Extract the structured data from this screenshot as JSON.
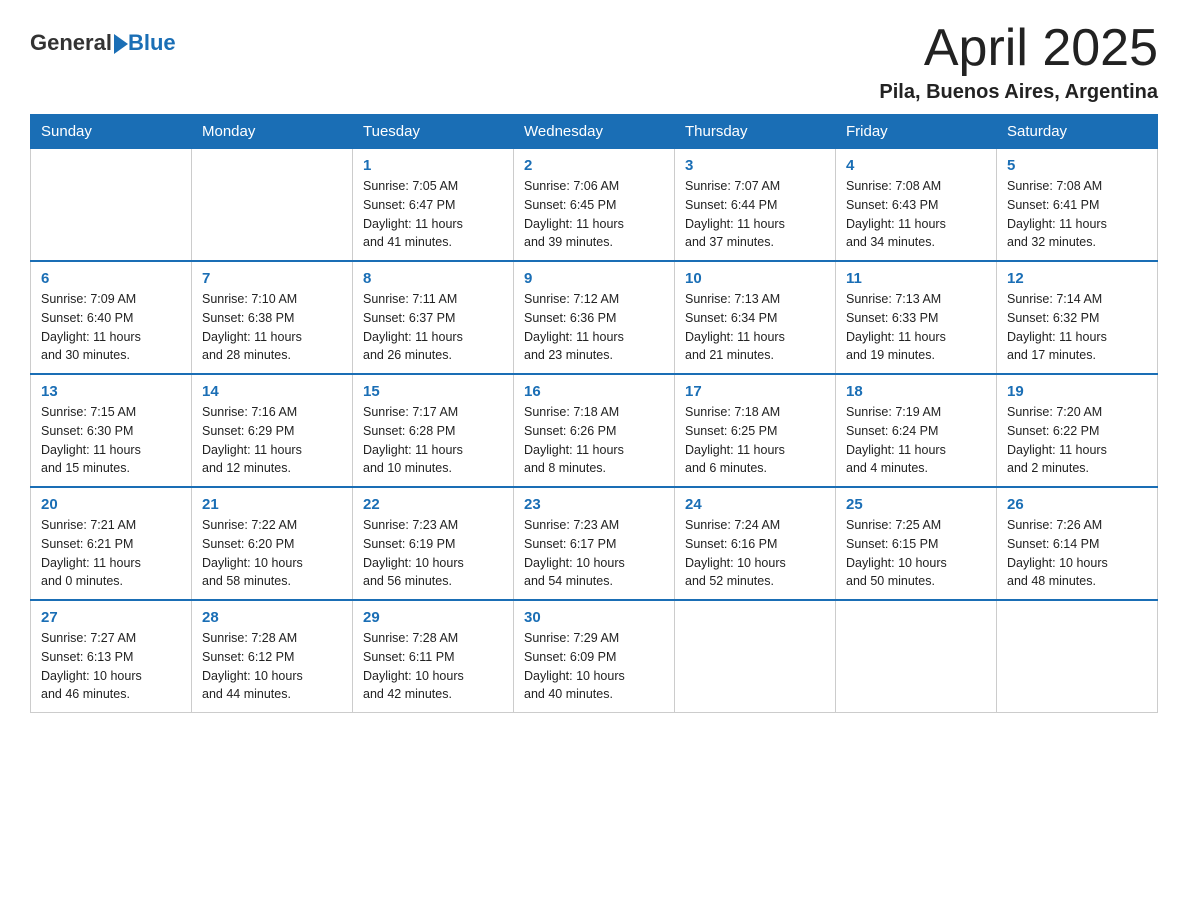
{
  "header": {
    "title": "April 2025",
    "subtitle": "Pila, Buenos Aires, Argentina",
    "logo_general": "General",
    "logo_blue": "Blue"
  },
  "days_of_week": [
    "Sunday",
    "Monday",
    "Tuesday",
    "Wednesday",
    "Thursday",
    "Friday",
    "Saturday"
  ],
  "weeks": [
    [
      {
        "day": "",
        "info": ""
      },
      {
        "day": "",
        "info": ""
      },
      {
        "day": "1",
        "info": "Sunrise: 7:05 AM\nSunset: 6:47 PM\nDaylight: 11 hours\nand 41 minutes."
      },
      {
        "day": "2",
        "info": "Sunrise: 7:06 AM\nSunset: 6:45 PM\nDaylight: 11 hours\nand 39 minutes."
      },
      {
        "day": "3",
        "info": "Sunrise: 7:07 AM\nSunset: 6:44 PM\nDaylight: 11 hours\nand 37 minutes."
      },
      {
        "day": "4",
        "info": "Sunrise: 7:08 AM\nSunset: 6:43 PM\nDaylight: 11 hours\nand 34 minutes."
      },
      {
        "day": "5",
        "info": "Sunrise: 7:08 AM\nSunset: 6:41 PM\nDaylight: 11 hours\nand 32 minutes."
      }
    ],
    [
      {
        "day": "6",
        "info": "Sunrise: 7:09 AM\nSunset: 6:40 PM\nDaylight: 11 hours\nand 30 minutes."
      },
      {
        "day": "7",
        "info": "Sunrise: 7:10 AM\nSunset: 6:38 PM\nDaylight: 11 hours\nand 28 minutes."
      },
      {
        "day": "8",
        "info": "Sunrise: 7:11 AM\nSunset: 6:37 PM\nDaylight: 11 hours\nand 26 minutes."
      },
      {
        "day": "9",
        "info": "Sunrise: 7:12 AM\nSunset: 6:36 PM\nDaylight: 11 hours\nand 23 minutes."
      },
      {
        "day": "10",
        "info": "Sunrise: 7:13 AM\nSunset: 6:34 PM\nDaylight: 11 hours\nand 21 minutes."
      },
      {
        "day": "11",
        "info": "Sunrise: 7:13 AM\nSunset: 6:33 PM\nDaylight: 11 hours\nand 19 minutes."
      },
      {
        "day": "12",
        "info": "Sunrise: 7:14 AM\nSunset: 6:32 PM\nDaylight: 11 hours\nand 17 minutes."
      }
    ],
    [
      {
        "day": "13",
        "info": "Sunrise: 7:15 AM\nSunset: 6:30 PM\nDaylight: 11 hours\nand 15 minutes."
      },
      {
        "day": "14",
        "info": "Sunrise: 7:16 AM\nSunset: 6:29 PM\nDaylight: 11 hours\nand 12 minutes."
      },
      {
        "day": "15",
        "info": "Sunrise: 7:17 AM\nSunset: 6:28 PM\nDaylight: 11 hours\nand 10 minutes."
      },
      {
        "day": "16",
        "info": "Sunrise: 7:18 AM\nSunset: 6:26 PM\nDaylight: 11 hours\nand 8 minutes."
      },
      {
        "day": "17",
        "info": "Sunrise: 7:18 AM\nSunset: 6:25 PM\nDaylight: 11 hours\nand 6 minutes."
      },
      {
        "day": "18",
        "info": "Sunrise: 7:19 AM\nSunset: 6:24 PM\nDaylight: 11 hours\nand 4 minutes."
      },
      {
        "day": "19",
        "info": "Sunrise: 7:20 AM\nSunset: 6:22 PM\nDaylight: 11 hours\nand 2 minutes."
      }
    ],
    [
      {
        "day": "20",
        "info": "Sunrise: 7:21 AM\nSunset: 6:21 PM\nDaylight: 11 hours\nand 0 minutes."
      },
      {
        "day": "21",
        "info": "Sunrise: 7:22 AM\nSunset: 6:20 PM\nDaylight: 10 hours\nand 58 minutes."
      },
      {
        "day": "22",
        "info": "Sunrise: 7:23 AM\nSunset: 6:19 PM\nDaylight: 10 hours\nand 56 minutes."
      },
      {
        "day": "23",
        "info": "Sunrise: 7:23 AM\nSunset: 6:17 PM\nDaylight: 10 hours\nand 54 minutes."
      },
      {
        "day": "24",
        "info": "Sunrise: 7:24 AM\nSunset: 6:16 PM\nDaylight: 10 hours\nand 52 minutes."
      },
      {
        "day": "25",
        "info": "Sunrise: 7:25 AM\nSunset: 6:15 PM\nDaylight: 10 hours\nand 50 minutes."
      },
      {
        "day": "26",
        "info": "Sunrise: 7:26 AM\nSunset: 6:14 PM\nDaylight: 10 hours\nand 48 minutes."
      }
    ],
    [
      {
        "day": "27",
        "info": "Sunrise: 7:27 AM\nSunset: 6:13 PM\nDaylight: 10 hours\nand 46 minutes."
      },
      {
        "day": "28",
        "info": "Sunrise: 7:28 AM\nSunset: 6:12 PM\nDaylight: 10 hours\nand 44 minutes."
      },
      {
        "day": "29",
        "info": "Sunrise: 7:28 AM\nSunset: 6:11 PM\nDaylight: 10 hours\nand 42 minutes."
      },
      {
        "day": "30",
        "info": "Sunrise: 7:29 AM\nSunset: 6:09 PM\nDaylight: 10 hours\nand 40 minutes."
      },
      {
        "day": "",
        "info": ""
      },
      {
        "day": "",
        "info": ""
      },
      {
        "day": "",
        "info": ""
      }
    ]
  ]
}
